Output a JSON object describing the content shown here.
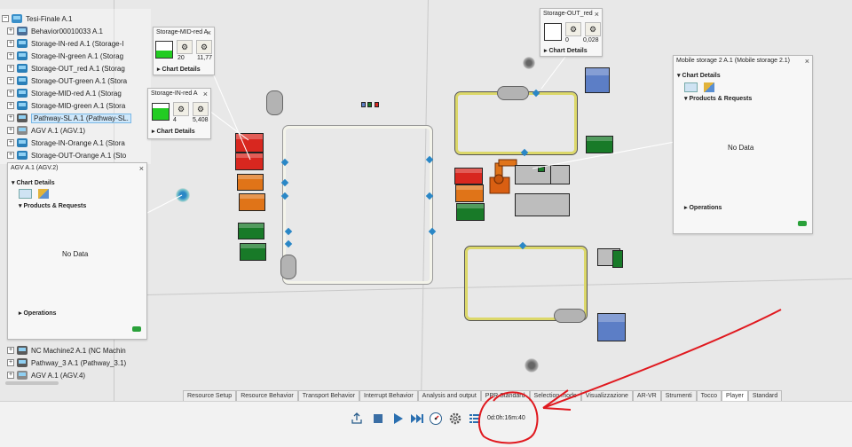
{
  "tree": {
    "root": "Tesi-Finale A.1",
    "items": [
      "Behavior00010033 A.1",
      "Storage-IN-red A.1 (Storage-I",
      "Storage-IN-green A.1 (Storag",
      "Storage-OUT_red A.1 (Storag",
      "Storage-OUT-green A.1 (Stora",
      "Storage-MID-red A.1 (Storag",
      "Storage-MID-green A.1 (Stora",
      "Pathway-SL A.1 (Pathway-SL.",
      "AGV A.1 (AGV.1)",
      "Storage-IN-Orange A.1 (Stora",
      "Storage-OUT-Orange A.1 (Sto"
    ],
    "bottom_items": [
      "NC Machine2 A.1 (NC Machin",
      "Pathway_3 A.1 (Pathway_3.1)",
      "AGV A.1 (AGV.4)"
    ]
  },
  "panels": {
    "agv": {
      "title": "AGV A.1 (AGV.2)",
      "chart_details": "Chart Details",
      "products": "Products & Requests",
      "no_data": "No Data",
      "operations": "Operations"
    },
    "mobile": {
      "title": "Mobile storage 2 A.1 (Mobile storage 2.1)",
      "chart_details": "Chart Details",
      "products": "Products & Requests",
      "no_data": "No Data",
      "operations": "Operations"
    },
    "mid_red": {
      "title": "Storage-MID-red A",
      "value_a": "20",
      "value_b": "11,77",
      "chart_details": "Chart Details",
      "fill_fraction": 0.45
    },
    "in_red": {
      "title": "Storage-IN-red A",
      "value_a": "4",
      "value_b": "5,408",
      "chart_details": "Chart Details",
      "fill_fraction": 0.75
    },
    "out_red": {
      "title": "Storage-OUT_red",
      "value_a": "0",
      "value_b": "0,028",
      "chart_details": "Chart Details",
      "fill_fraction": 0
    }
  },
  "close_glyph": "×",
  "tabs": [
    {
      "label": "Resource Setup",
      "active": false
    },
    {
      "label": "Resource Behavior",
      "active": false
    },
    {
      "label": "Transport Behavior",
      "active": false
    },
    {
      "label": "Interrupt Behavior",
      "active": false
    },
    {
      "label": "Analysis and output",
      "active": false
    },
    {
      "label": "PPR Standard",
      "active": false
    },
    {
      "label": "Selection mode",
      "active": false
    },
    {
      "label": "Visualizzazione",
      "active": false
    },
    {
      "label": "AR-VR",
      "active": false
    },
    {
      "label": "Strumenti",
      "active": false
    },
    {
      "label": "Tocco",
      "active": false
    },
    {
      "label": "Player",
      "active": true
    },
    {
      "label": "Standard",
      "active": false
    }
  ],
  "player": {
    "timer": "0d:0h:16m:40"
  },
  "colors": {
    "accent_blue": "#2a87c6",
    "annotation_red": "#e0191f",
    "fill_green": "#22cc22"
  }
}
